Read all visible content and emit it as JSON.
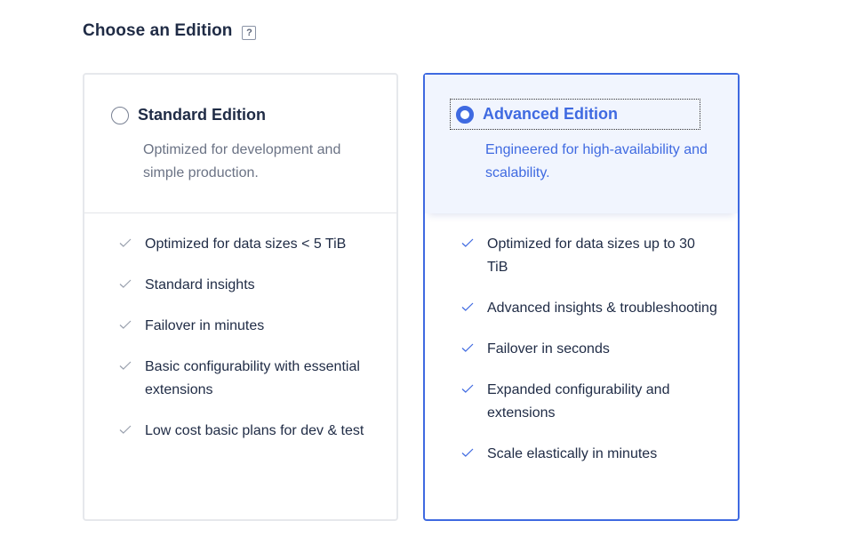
{
  "heading": {
    "label": "Choose an Edition",
    "help_glyph": "?"
  },
  "editions": [
    {
      "name": "Standard Edition",
      "description": "Optimized for development and simple production.",
      "selected": false,
      "features": [
        "Optimized for data sizes < 5 TiB",
        "Standard insights",
        "Failover in minutes",
        "Basic configurability with essential extensions",
        "Low cost basic plans for dev & test"
      ]
    },
    {
      "name": "Advanced Edition",
      "description": "Engineered for high-availability and scalability.",
      "selected": true,
      "features": [
        "Optimized for data sizes up to 30 TiB",
        "Advanced insights & troubleshooting",
        "Failover in seconds",
        "Expanded configurability and extensions",
        "Scale elastically in minutes"
      ]
    }
  ],
  "icons": {
    "help": "help-icon",
    "radio": "radio-icon",
    "feature": "check-icon"
  },
  "colors": {
    "accent": "#3f6ae1",
    "text": "#1f2b45",
    "muted": "#6b7385",
    "selected_header_bg": "#f1f5fe"
  }
}
